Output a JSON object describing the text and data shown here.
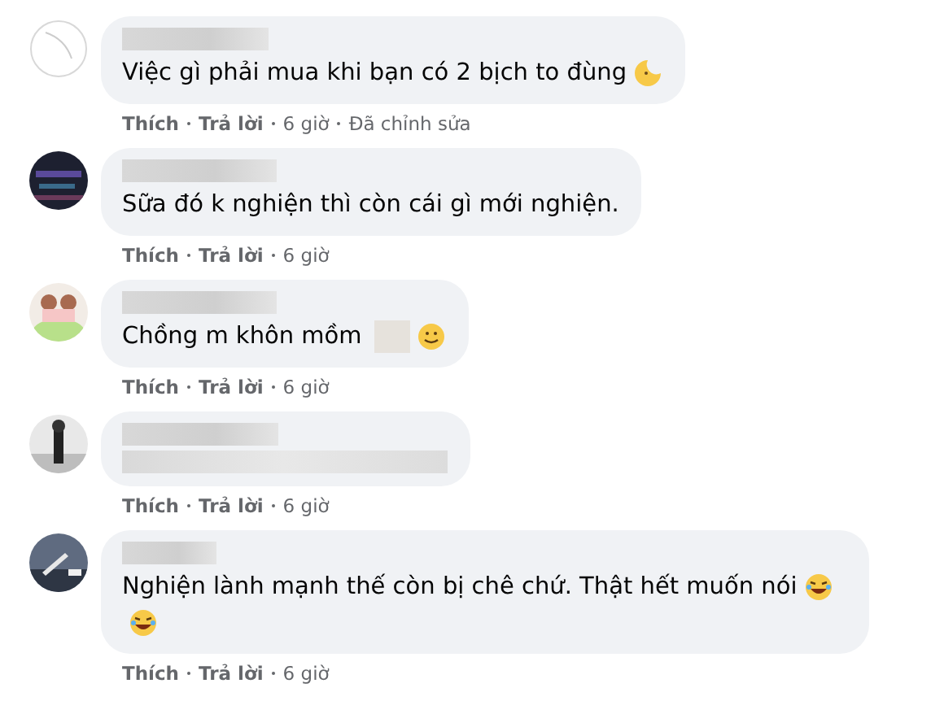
{
  "comments": [
    {
      "body": "Việc gì phải mua khi bạn có 2 bịch to đùng",
      "emojis": [
        {
          "kind": "moon"
        }
      ],
      "actions": {
        "like": "Thích",
        "reply": "Trả lời",
        "time": "6 giờ",
        "edited": "Đã chỉnh sửa"
      }
    },
    {
      "body": "Sữa đó k nghiện thì còn cái gì mới nghiện.",
      "actions": {
        "like": "Thích",
        "reply": "Trả lời",
        "time": "6 giờ"
      }
    },
    {
      "body": "Chồng m khôn mồm",
      "emojis": [
        {
          "kind": "blur"
        },
        {
          "kind": "smile"
        }
      ],
      "actions": {
        "like": "Thích",
        "reply": "Trả lời",
        "time": "6 giờ"
      }
    },
    {
      "actions": {
        "like": "Thích",
        "reply": "Trả lời",
        "time": "6 giờ"
      }
    },
    {
      "body": "Nghiện lành mạnh thế còn bị chê chứ. Thật hết muốn nói",
      "emojis": [
        {
          "kind": "laugh"
        },
        {
          "kind": "laugh"
        }
      ],
      "actions": {
        "like": "Thích",
        "reply": "Trả lời",
        "time": "6 giờ"
      }
    }
  ]
}
